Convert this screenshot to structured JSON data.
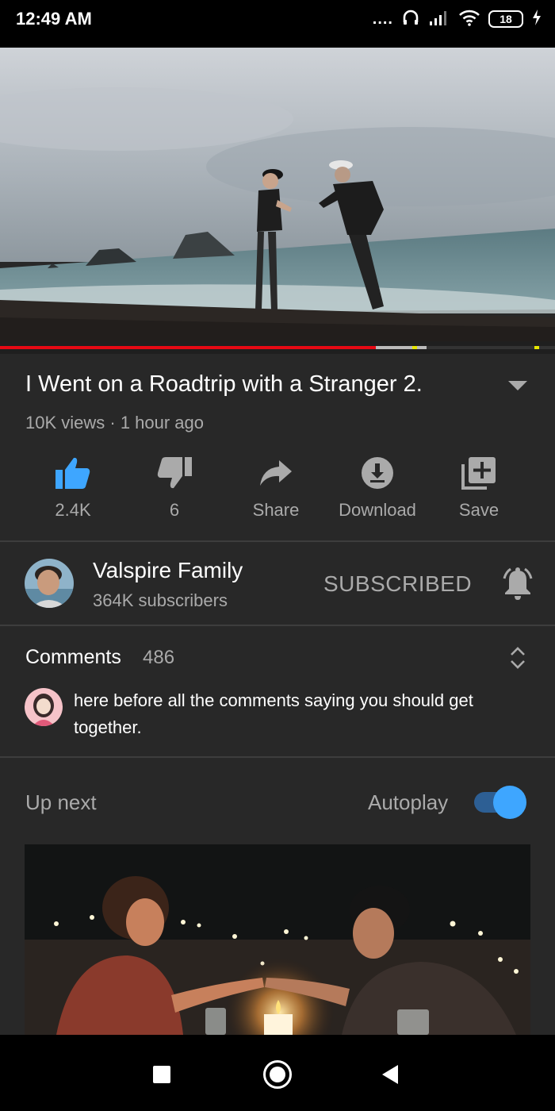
{
  "status_bar": {
    "time": "12:49 AM",
    "dots": "....",
    "battery": "18",
    "icons": [
      "headphones-icon",
      "signal-icon",
      "wifi-icon",
      "battery-icon",
      "charging-icon"
    ]
  },
  "video": {
    "title": "I Went on a Roadtrip with a Stranger 2.",
    "meta": "10K views · 1 hour ago",
    "progress_played_fraction": 0.68,
    "progress_buffered_fraction": 0.77
  },
  "actions": [
    {
      "icon": "thumbs-up-icon",
      "label": "2.4K",
      "color": "#3ea6ff"
    },
    {
      "icon": "thumbs-down-icon",
      "label": "6",
      "color": "#aaaaaa"
    },
    {
      "icon": "share-icon",
      "label": "Share",
      "color": "#aaaaaa"
    },
    {
      "icon": "download-icon",
      "label": "Download",
      "color": "#aaaaaa"
    },
    {
      "icon": "save-playlist-icon",
      "label": "Save",
      "color": "#aaaaaa"
    }
  ],
  "channel": {
    "name": "Valspire Family",
    "subscribers": "364K subscribers",
    "subscribe_state": "SUBSCRIBED"
  },
  "comments": {
    "label": "Comments",
    "count": "486",
    "top_comment": "here before all the comments saying you should get together."
  },
  "up_next": {
    "label": "Up next",
    "autoplay_label": "Autoplay",
    "autoplay_on": true
  },
  "colors": {
    "background": "#282828",
    "accent_blue": "#3ea6ff",
    "progress_red": "#e50914"
  }
}
